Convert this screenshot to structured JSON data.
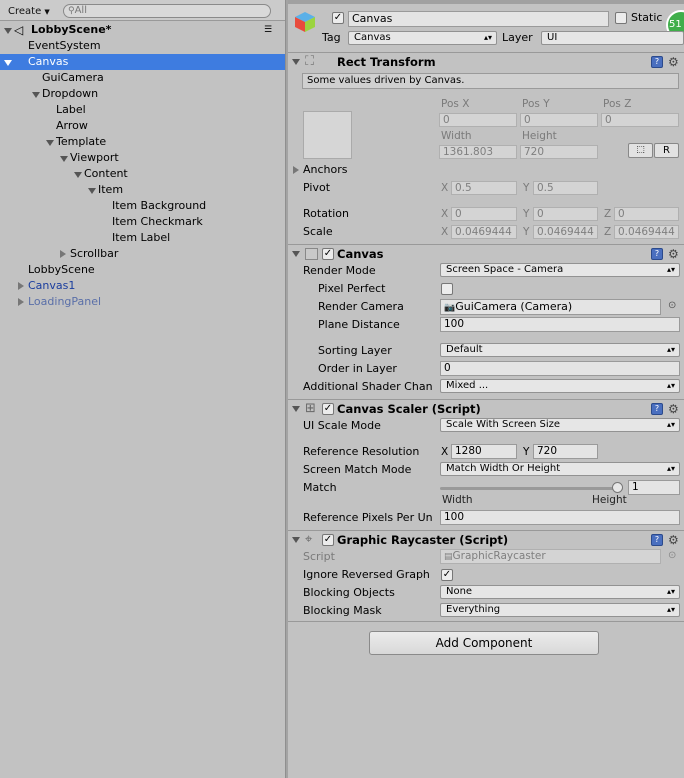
{
  "hierarchy": {
    "create_label": "Create",
    "search_placeholder": "All",
    "scene_name": "LobbyScene*",
    "items": [
      {
        "label": "EventSystem"
      },
      {
        "label": "Canvas"
      },
      {
        "label": "GuiCamera"
      },
      {
        "label": "Dropdown"
      },
      {
        "label": "Label"
      },
      {
        "label": "Arrow"
      },
      {
        "label": "Template"
      },
      {
        "label": "Viewport"
      },
      {
        "label": "Content"
      },
      {
        "label": "Item"
      },
      {
        "label": "Item Background"
      },
      {
        "label": "Item Checkmark"
      },
      {
        "label": "Item Label"
      },
      {
        "label": "Scrollbar"
      },
      {
        "label": "LobbyScene"
      },
      {
        "label": "Canvas1"
      },
      {
        "label": "LoadingPanel"
      }
    ]
  },
  "inspector": {
    "object_name": "Canvas",
    "static_label": "Static",
    "tag_label": "Tag",
    "tag_value": "Canvas",
    "layer_label": "Layer",
    "layer_value": "UI",
    "badge": "51",
    "rect_transform": {
      "title": "Rect Transform",
      "note": "Some values driven by Canvas.",
      "pos_x_label": "Pos X",
      "pos_y_label": "Pos Y",
      "pos_z_label": "Pos Z",
      "pos_x": "0",
      "pos_y": "0",
      "pos_z": "0",
      "width_label": "Width",
      "height_label": "Height",
      "width": "1361.803",
      "height": "720",
      "r_button": "R",
      "anchors_label": "Anchors",
      "pivot_label": "Pivot",
      "pivot_x": "0.5",
      "pivot_y": "0.5",
      "rotation_label": "Rotation",
      "rot_x": "0",
      "rot_y": "0",
      "rot_z": "0",
      "scale_label": "Scale",
      "scale_x": "0.0469444",
      "scale_y": "0.0469444",
      "scale_z": "0.0469444",
      "x": "X",
      "y": "Y",
      "z": "Z"
    },
    "canvas": {
      "title": "Canvas",
      "render_mode_label": "Render Mode",
      "render_mode": "Screen Space - Camera",
      "pixel_perfect_label": "Pixel Perfect",
      "render_camera_label": "Render Camera",
      "render_camera": "GuiCamera (Camera)",
      "plane_distance_label": "Plane Distance",
      "plane_distance": "100",
      "sorting_layer_label": "Sorting Layer",
      "sorting_layer": "Default",
      "order_in_layer_label": "Order in Layer",
      "order_in_layer": "0",
      "additional_shader_label": "Additional Shader Chan",
      "additional_shader": "Mixed ..."
    },
    "canvas_scaler": {
      "title": "Canvas Scaler (Script)",
      "ui_scale_mode_label": "UI Scale Mode",
      "ui_scale_mode": "Scale With Screen Size",
      "ref_res_label": "Reference Resolution",
      "ref_x": "1280",
      "ref_y": "720",
      "screen_match_label": "Screen Match Mode",
      "screen_match": "Match Width Or Height",
      "match_label": "Match",
      "match_value": "1",
      "width_label": "Width",
      "height_label": "Height",
      "ref_pixels_label": "Reference Pixels Per Un",
      "ref_pixels": "100"
    },
    "graphic_raycaster": {
      "title": "Graphic Raycaster (Script)",
      "script_label": "Script",
      "script_value": "GraphicRaycaster",
      "ignore_reversed_label": "Ignore Reversed Graph",
      "blocking_objects_label": "Blocking Objects",
      "blocking_objects": "None",
      "blocking_mask_label": "Blocking Mask",
      "blocking_mask": "Everything"
    },
    "add_component": "Add Component"
  }
}
